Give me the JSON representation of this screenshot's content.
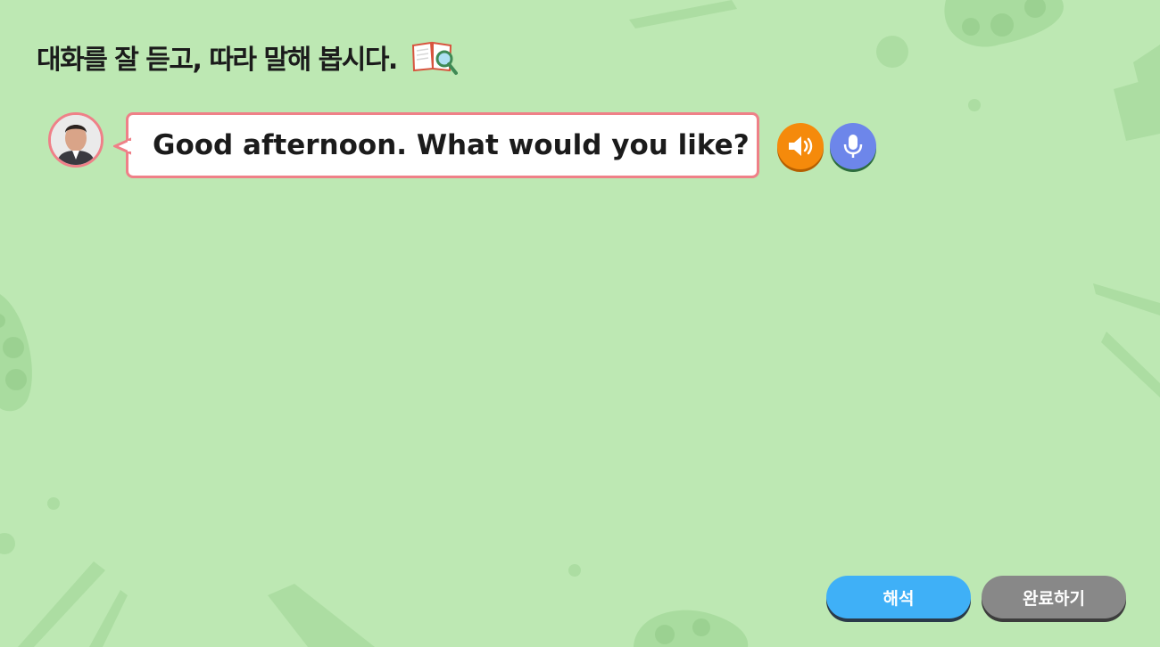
{
  "instruction": {
    "text": "대화를 잘 듣고, 따라 말해 봅시다.",
    "icon": "book-magnifier-icon"
  },
  "dialogue": {
    "speaker_icon": "teacher-avatar",
    "line": "Good afternoon. What would you like?"
  },
  "controls": {
    "play_icon": "speaker-icon",
    "record_icon": "microphone-icon"
  },
  "footer": {
    "translate_label": "해석",
    "complete_label": "완료하기"
  },
  "colors": {
    "background": "#bde8b3",
    "bubble_border": "#ef8088",
    "speaker_button": "#f58a0b",
    "mic_button": "#6d86ea",
    "translate_button": "#3fb0f7",
    "complete_button": "#888888"
  }
}
